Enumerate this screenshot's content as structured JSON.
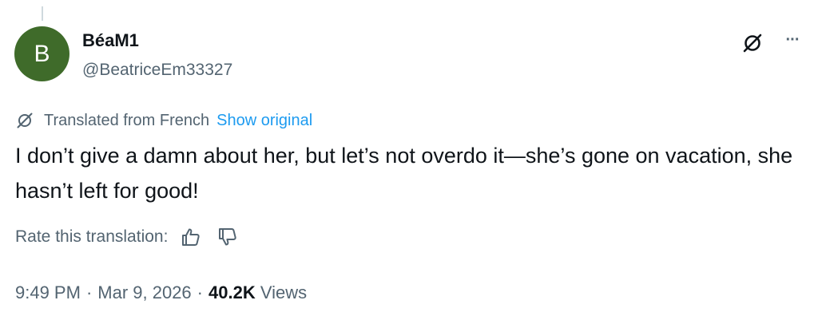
{
  "author": {
    "avatar_initial": "B",
    "avatar_color": "#3f6b2a",
    "display_name": "BéaM1",
    "handle": "@BeatriceEm33327"
  },
  "header_actions": {
    "no_translate_icon": "translate-off-icon",
    "more_icon": "more-horizontal-icon",
    "more_label": "···"
  },
  "translation": {
    "icon": "translate-off-icon",
    "translated_from": "Translated from French",
    "show_original": "Show original"
  },
  "tweet": {
    "text": "I don’t give a damn about her, but let’s not overdo it—she’s gone on vacation, she hasn’t left for good!"
  },
  "rating": {
    "label": "Rate this translation:",
    "thumb_up_icon": "thumbs-up-icon",
    "thumb_down_icon": "thumbs-down-icon"
  },
  "meta": {
    "time": "9:49 PM",
    "separator": "·",
    "date": "Mar 9, 2026",
    "views_count": "40.2K",
    "views_label": "Views"
  },
  "colors": {
    "link": "#1d9bf0",
    "secondary_text": "#536471",
    "primary_text": "#0f1419"
  }
}
